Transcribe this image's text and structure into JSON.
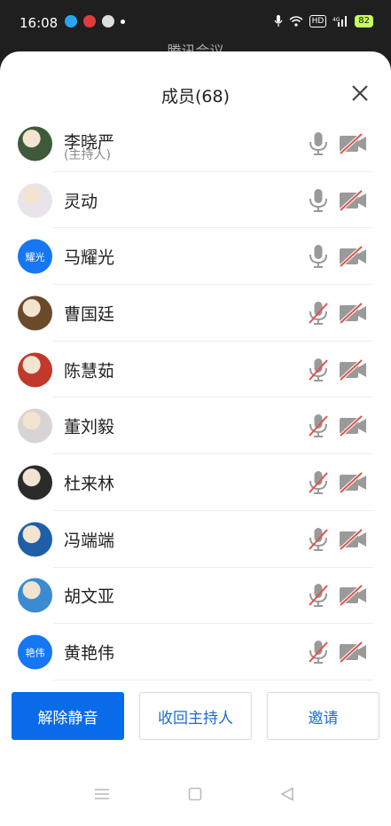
{
  "status_bar": {
    "time": "16:08",
    "battery": "82",
    "hd_label": "HD"
  },
  "background_title": "腾讯会议",
  "sheet": {
    "title": "成员(68)"
  },
  "members": [
    {
      "name": "李晓严",
      "sub": "(主持人)",
      "avatar_type": "photo",
      "avatar_color": "#3f5a3a",
      "mic_muted": false,
      "cam_off": true
    },
    {
      "name": "灵动",
      "sub": "",
      "avatar_type": "photo",
      "avatar_color": "#e8e4ea",
      "mic_muted": false,
      "cam_off": true
    },
    {
      "name": "马耀光",
      "sub": "",
      "avatar_type": "text",
      "avatar_text": "耀光",
      "avatar_color": "#1677f2",
      "mic_muted": false,
      "cam_off": true
    },
    {
      "name": "曹国廷",
      "sub": "",
      "avatar_type": "photo",
      "avatar_color": "#6b4a2a",
      "mic_muted": true,
      "cam_off": true
    },
    {
      "name": "陈慧茹",
      "sub": "",
      "avatar_type": "photo",
      "avatar_color": "#c0392b",
      "mic_muted": true,
      "cam_off": true
    },
    {
      "name": "董刘毅",
      "sub": "",
      "avatar_type": "photo",
      "avatar_color": "#d9d4d4",
      "mic_muted": true,
      "cam_off": true
    },
    {
      "name": "杜来林",
      "sub": "",
      "avatar_type": "photo",
      "avatar_color": "#2b2b2b",
      "mic_muted": true,
      "cam_off": true
    },
    {
      "name": "冯端端",
      "sub": "",
      "avatar_type": "photo",
      "avatar_color": "#1e5fa8",
      "mic_muted": true,
      "cam_off": true
    },
    {
      "name": "胡文亚",
      "sub": "",
      "avatar_type": "photo",
      "avatar_color": "#3a8bd0",
      "mic_muted": true,
      "cam_off": true
    },
    {
      "name": "黄艳伟",
      "sub": "",
      "avatar_type": "text",
      "avatar_text": "艳伟",
      "avatar_color": "#1677f2",
      "mic_muted": true,
      "cam_off": true
    }
  ],
  "actions": {
    "unmute_all": "解除静音",
    "revoke_host": "收回主持人",
    "invite": "邀请"
  },
  "colors": {
    "accent": "#0a6bea",
    "muted_red": "#e0524a",
    "icon_gray": "#9a9a9a"
  }
}
